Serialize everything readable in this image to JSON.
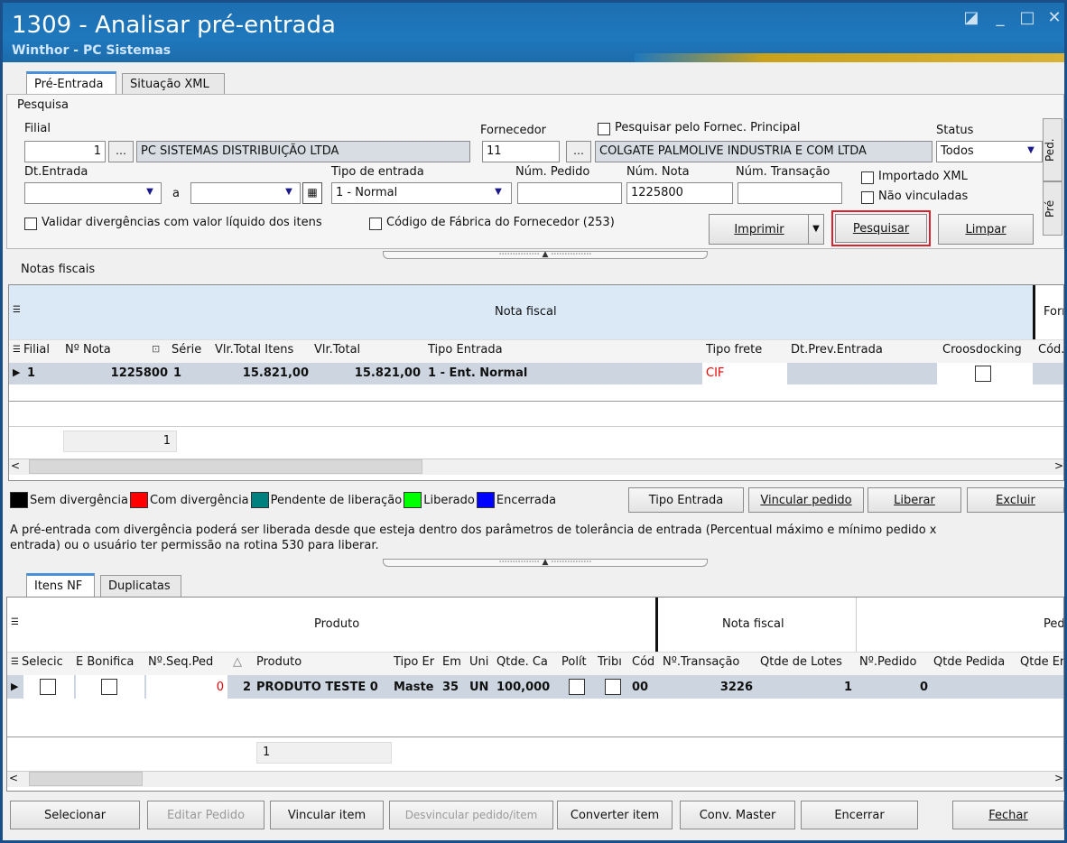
{
  "window": {
    "title": "1309 - Analisar pré-entrada",
    "subtitle": "Winthor - PC Sistemas"
  },
  "top_tabs": [
    {
      "label": "Pré-Entrada"
    },
    {
      "label": "Situação XML"
    }
  ],
  "search": {
    "group_label": "Pesquisa",
    "filial_label": "Filial",
    "filial_code": "1",
    "filial_name": "PC SISTEMAS DISTRIBUIÇÃO LTDA",
    "fornecedor_label": "Fornecedor",
    "fornecedor_code": "11",
    "fornecedor_name": "COLGATE PALMOLIVE INDUSTRIA  E COM LTDA",
    "fornec_principal_label": "Pesquisar pelo Fornec. Principal",
    "status_label": "Status",
    "status_value": "Todos",
    "dt_entrada_label": "Dt.Entrada",
    "a_label": "a",
    "tipo_entrada_label": "Tipo de entrada",
    "tipo_entrada_value": "1 - Normal",
    "num_pedido_label": "Núm. Pedido",
    "num_pedido_value": "",
    "num_nota_label": "Núm. Nota",
    "num_nota_value": "1225800",
    "num_transacao_label": "Núm. Transação",
    "num_transacao_value": "",
    "importado_xml_label": "Importado XML",
    "nao_vinculadas_label": "Não vinculadas",
    "validar_label": "Validar divergências com valor líquido dos itens",
    "cod_fabrica_label": "Código de Fábrica do Fornecedor (253)",
    "imprimir_label": "Imprimir",
    "pesquisar_label": "Pesquisar",
    "limpar_label": "Limpar",
    "side_tab_ped": "Ped.",
    "side_tab_pre": "Pré"
  },
  "notas": {
    "group_label": "Notas fiscais",
    "band_label": "Nota fiscal",
    "band2_label": "Forr",
    "columns": [
      "Filial",
      "Nº Nota",
      "Série",
      "Vlr.Total Itens",
      "Vlr.Total",
      "Tipo Entrada",
      "Tipo frete",
      "Dt.Prev.Entrada",
      "Croosdocking",
      "Cód."
    ],
    "rows": [
      {
        "filial": "1",
        "nota": "1225800",
        "serie": "1",
        "vlr_itens": "15.821,00",
        "vlr_total": "15.821,00",
        "tipo": "1 - Ent. Normal",
        "frete": "CIF",
        "dtprev": ""
      }
    ],
    "footer_count": "1"
  },
  "legend": [
    {
      "color": "#000000",
      "label": "Sem divergência"
    },
    {
      "color": "#ff0000",
      "label": "Com divergência"
    },
    {
      "color": "#00807f",
      "label": "Pendente de liberação"
    },
    {
      "color": "#00ff00",
      "label": "Liberado"
    },
    {
      "color": "#0000ff",
      "label": "Encerrada"
    }
  ],
  "actions1": {
    "tipo_entrada": "Tipo Entrada",
    "vincular": "Vincular pedido",
    "liberar": "Liberar",
    "excluir": "Excluir"
  },
  "info_text_line1": "A pré-entrada com divergência poderá ser liberada desde que esteja dentro dos parâmetros de tolerância de entrada (Percentual máximo e mínimo pedido x",
  "info_text_line2": "entrada) ou o usuário ter permissão na rotina 530 para liberar.",
  "bottom_tabs": [
    {
      "label": "Itens NF"
    },
    {
      "label": "Duplicatas"
    }
  ],
  "itens": {
    "band_produto": "Produto",
    "band_nota": "Nota fiscal",
    "band_ped": "Ped",
    "columns": [
      "Selecic",
      "E Bonifica",
      "Nº.Seq.Ped",
      "△",
      "Produto",
      "Tipo Er",
      "Em",
      "Uni",
      "Qtde. Ca",
      "Polít",
      "Tribı",
      "Cód",
      "Nº.Transação",
      "Qtde de Lotes",
      "Nº.Pedido",
      "Qtde Pedida",
      "Qtde Er"
    ],
    "row": {
      "seq": "0",
      "num": "2",
      "produto": "PRODUTO TESTE 0",
      "tipo": "Maste",
      "em": "35",
      "uni": "UN",
      "qtde": "100,000",
      "cod": "00",
      "transacao": "3226",
      "lotes": "1",
      "pedido": "0"
    },
    "footer_count": "1"
  },
  "bottom_buttons": {
    "selecionar": "Selecionar",
    "editar": "Editar Pedido",
    "vincular_item": "Vincular item",
    "desvincular": "Desvincular pedido/item",
    "converter": "Converter item",
    "conv_master": "Conv. Master",
    "encerrar": "Encerrar",
    "fechar": "Fechar"
  },
  "highlight_color": "#d9232e"
}
